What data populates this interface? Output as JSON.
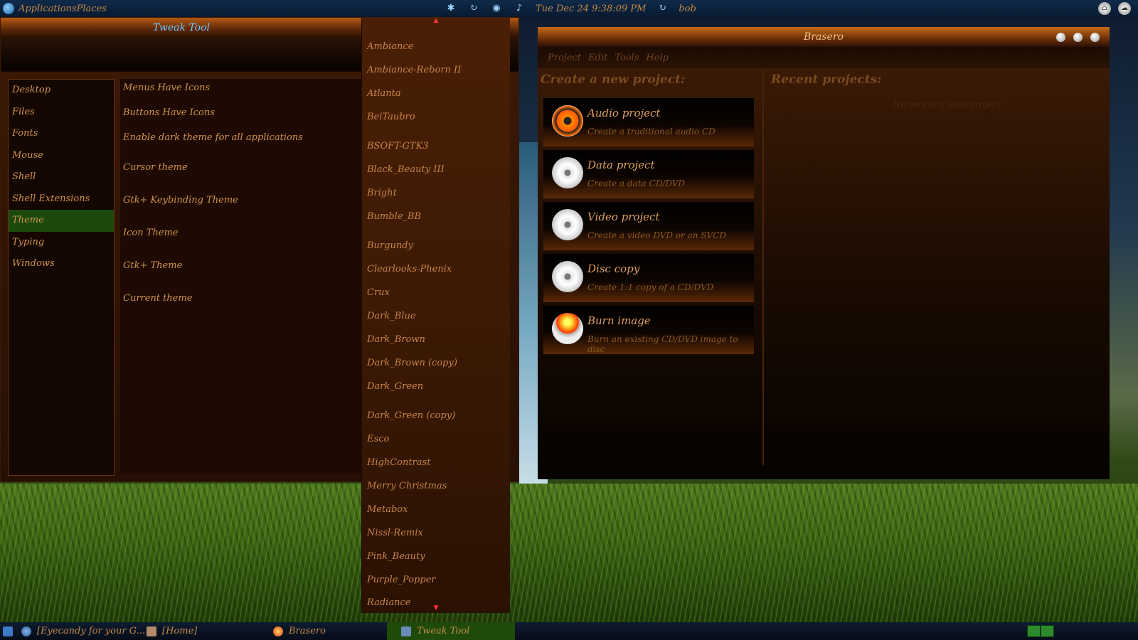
{
  "top_panel": {
    "menu_applications": "Applications",
    "menu_places": "Places",
    "clock": "Tue Dec 24  9:38:09 PM",
    "user": "bob"
  },
  "tweak_tool": {
    "title": "Tweak Tool",
    "sidebar": [
      "Desktop",
      "Files",
      "Fonts",
      "Mouse",
      "Shell",
      "Shell Extensions",
      "Theme",
      "Typing",
      "Windows"
    ],
    "active_section": "Theme",
    "settings": [
      "Menus Have Icons",
      "Buttons Have Icons",
      "Enable dark theme for all applications",
      "Cursor theme",
      "Gtk+ Keybinding Theme",
      "Icon Theme",
      "Gtk+ Theme",
      "Current theme"
    ]
  },
  "theme_dropdown": {
    "items": [
      "Ambiance",
      "Ambiance-Reborn II",
      "Atlanta",
      "BeiTaubro",
      "BSOFT-GTK3",
      "Black_Beauty III",
      "Bright",
      "Bumble_BB",
      "Burgundy",
      "Clearlooks-Phenix",
      "Crux",
      "Dark_Blue",
      "Dark_Brown",
      "Dark_Brown (copy)",
      "Dark_Green",
      "Dark_Green (copy)",
      "Esco",
      "HighContrast",
      "Merry Christmas",
      "Metabox",
      "Nissl-Remix",
      "Pink_Beauty",
      "Purple_Popper",
      "Radiance"
    ]
  },
  "brasero": {
    "title": "Brasero",
    "menu": [
      "Project",
      "Edit",
      "Tools",
      "Help"
    ],
    "create_heading": "Create a new project:",
    "recent_heading": "Recent projects:",
    "no_recent": "No recently used project",
    "projects": [
      {
        "name": "Audio project",
        "desc": "Create a traditional audio CD",
        "icon": "radiation-icon"
      },
      {
        "name": "Data project",
        "desc": "Create a data CD/DVD",
        "icon": "data-disc-icon"
      },
      {
        "name": "Video project",
        "desc": "Create a video DVD or an SVCD",
        "icon": "video-disc-icon"
      },
      {
        "name": "Disc copy",
        "desc": "Create 1:1 copy of a CD/DVD",
        "icon": "disc-icon"
      },
      {
        "name": "Burn image",
        "desc": "Burn an existing CD/DVD image to disc",
        "icon": "burn-disc-icon"
      }
    ]
  },
  "taskbar": {
    "tasks": [
      "[Eyecandy for your G...",
      "[Home]",
      "Brasero",
      "Tweak Tool"
    ],
    "active_task": "Tweak Tool"
  },
  "colors": {
    "accent_text": "#d1944e",
    "window_bg": "#1e0a02",
    "titlebar": "#b65a12",
    "active_green": "#1b4a0c"
  }
}
